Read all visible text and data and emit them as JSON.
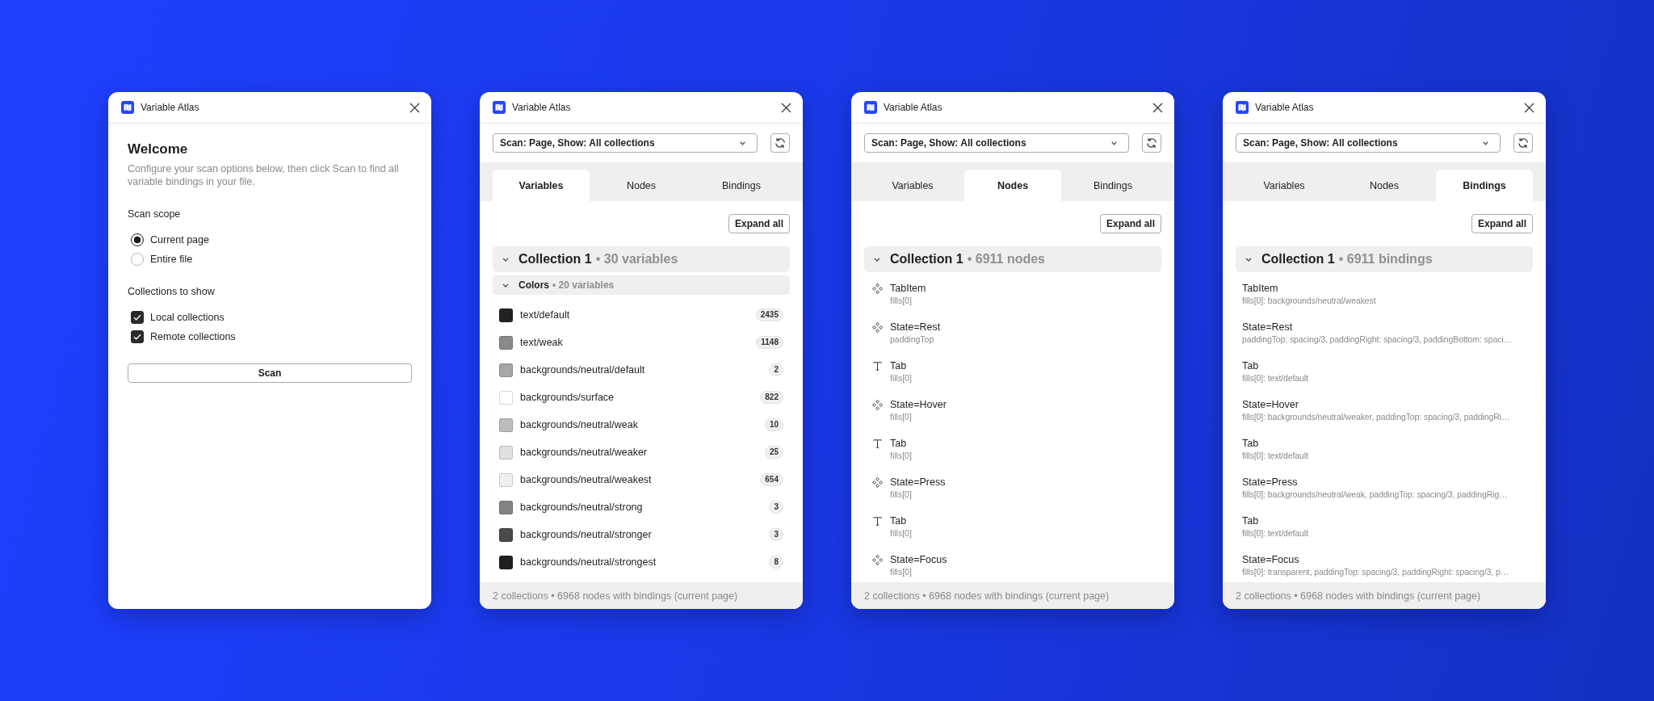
{
  "panels": [
    {
      "kind": "welcome",
      "window": {
        "title": "Variable Atlas"
      },
      "heading": "Welcome",
      "description": "Configure your scan options below, then click Scan to find all variable bindings in your file.",
      "scan_scope": {
        "label": "Scan scope",
        "options": [
          {
            "label": "Current page",
            "selected": true
          },
          {
            "label": "Entire file",
            "selected": false
          }
        ]
      },
      "collections_to_show": {
        "label": "Collections to show",
        "options": [
          {
            "label": "Local collections",
            "checked": true
          },
          {
            "label": "Remote collections",
            "checked": true
          }
        ]
      },
      "scan_button": "Scan"
    },
    {
      "kind": "variables",
      "window": {
        "title": "Variable Atlas"
      },
      "scan_select": {
        "value": "Scan: Page, Show: All collections"
      },
      "tabs": [
        {
          "label": "Variables",
          "selected": true
        },
        {
          "label": "Nodes",
          "selected": false
        },
        {
          "label": "Bindings",
          "selected": false
        }
      ],
      "expand_button": "Expand all",
      "collections": [
        {
          "name": "Collection 1",
          "meta": "• 30 variables",
          "expanded": true,
          "groups": [
            {
              "name": "Colors",
              "meta": "• 20 variables",
              "expanded": true,
              "variables": [
                {
                  "name": "text/default",
                  "color": "#222222",
                  "count": "2435"
                },
                {
                  "name": "text/weak",
                  "color": "#8a8a8a",
                  "count": "1148"
                },
                {
                  "name": "backgrounds/neutral/default",
                  "color": "#a6a6a6",
                  "count": "2"
                },
                {
                  "name": "backgrounds/surface",
                  "color": "#ffffff",
                  "count": "822"
                },
                {
                  "name": "backgrounds/neutral/weak",
                  "color": "#bcbcbc",
                  "count": "10"
                },
                {
                  "name": "backgrounds/neutral/weaker",
                  "color": "#e0e0e0",
                  "count": "25"
                },
                {
                  "name": "backgrounds/neutral/weakest",
                  "color": "#efefef",
                  "count": "654"
                },
                {
                  "name": "backgrounds/neutral/strong",
                  "color": "#828282",
                  "count": "3"
                },
                {
                  "name": "backgrounds/neutral/stronger",
                  "color": "#4a4a4a",
                  "count": "3"
                },
                {
                  "name": "backgrounds/neutral/strongest",
                  "color": "#1f1f1f",
                  "count": "8"
                }
              ]
            }
          ]
        }
      ],
      "status_bar": "2 collections • 6968 nodes with bindings (current page)"
    },
    {
      "kind": "nodes",
      "window": {
        "title": "Variable Atlas"
      },
      "scan_select": {
        "value": "Scan: Page, Show: All collections"
      },
      "tabs": [
        {
          "label": "Variables",
          "selected": false
        },
        {
          "label": "Nodes",
          "selected": true
        },
        {
          "label": "Bindings",
          "selected": false
        }
      ],
      "expand_button": "Expand all",
      "collections": [
        {
          "name": "Collection 1",
          "meta": "• 6911 nodes",
          "expanded": true,
          "nodes": [
            {
              "kind": "component",
              "name": "TabItem",
              "detail": "fills[0]"
            },
            {
              "kind": "component",
              "name": "State=Rest",
              "detail": "paddingTop"
            },
            {
              "kind": "text",
              "name": "Tab",
              "detail": "fills[0]"
            },
            {
              "kind": "component",
              "name": "State=Hover",
              "detail": "fills[0]"
            },
            {
              "kind": "text",
              "name": "Tab",
              "detail": "fills[0]"
            },
            {
              "kind": "component",
              "name": "State=Press",
              "detail": "fills[0]"
            },
            {
              "kind": "text",
              "name": "Tab",
              "detail": "fills[0]"
            },
            {
              "kind": "component",
              "name": "State=Focus",
              "detail": "fills[0]"
            }
          ]
        }
      ],
      "status_bar": "2 collections • 6968 nodes with bindings (current page)"
    },
    {
      "kind": "bindings",
      "window": {
        "title": "Variable Atlas"
      },
      "scan_select": {
        "value": "Scan: Page, Show: All collections"
      },
      "tabs": [
        {
          "label": "Variables",
          "selected": false
        },
        {
          "label": "Nodes",
          "selected": false
        },
        {
          "label": "Bindings",
          "selected": true
        }
      ],
      "expand_button": "Expand all",
      "collections": [
        {
          "name": "Collection 1",
          "meta": "• 6911 bindings",
          "expanded": true,
          "bindings": [
            {
              "name": "TabItem",
              "detail": "fills[0]: backgrounds/neutral/weakest"
            },
            {
              "name": "State=Rest",
              "detail": "paddingTop: spacing/3, paddingRight: spacing/3, paddingBottom: spaci…"
            },
            {
              "name": "Tab",
              "detail": "fills[0]: text/default"
            },
            {
              "name": "State=Hover",
              "detail": "fills[0]: backgrounds/neutral/weaker, paddingTop: spacing/3, paddingRi…"
            },
            {
              "name": "Tab",
              "detail": "fills[0]: text/default"
            },
            {
              "name": "State=Press",
              "detail": "fills[0]: backgrounds/neutral/weak, paddingTop: spacing/3, paddingRig…"
            },
            {
              "name": "Tab",
              "detail": "fills[0]: text/default"
            },
            {
              "name": "State=Focus",
              "detail": "fills[0]: transparent, paddingTop: spacing/3, paddingRight: spacing/3, p…"
            }
          ]
        }
      ],
      "status_bar": "2 collections • 6968 nodes with bindings (current page)"
    }
  ]
}
